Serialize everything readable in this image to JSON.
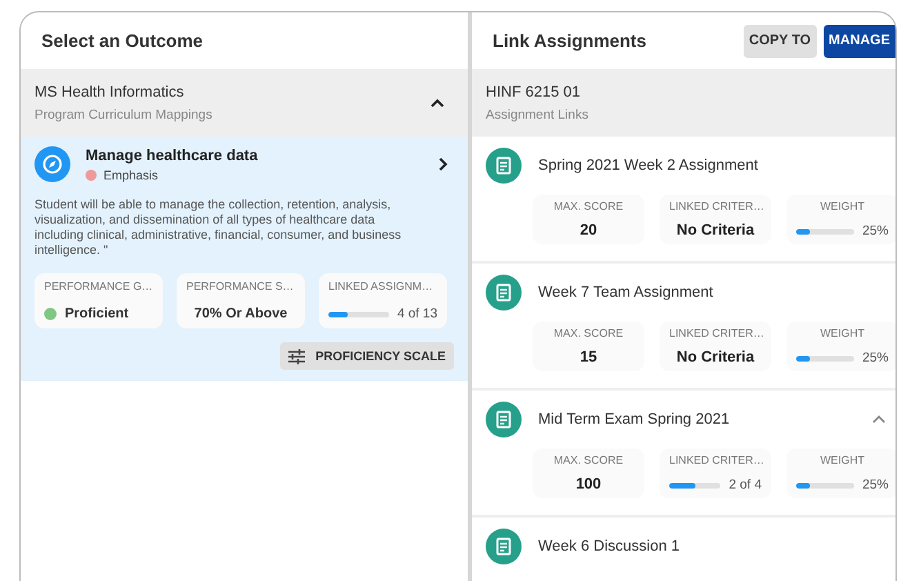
{
  "left_panel": {
    "title": "Select an Outcome",
    "program": {
      "name": "MS Health Informatics",
      "subtitle": "Program Curriculum Mappings",
      "expanded": true
    },
    "outcome": {
      "title": "Manage healthcare data",
      "tag": "Emphasis",
      "color": "#ef9a9a",
      "selected": true,
      "description": "Student will be able to manage the collection, retention, analysis, visualization, and dissemination of all types of healthcare data including clinical, administrative, financial, consumer, and business intelligence. \"",
      "stats": [
        {
          "kind": "dot",
          "label": "PERFORMANCE G…",
          "value": "Proficient",
          "color": "#81c784"
        },
        {
          "kind": "text",
          "label": "PERFORMANCE S…",
          "value": "70% Or Above"
        },
        {
          "kind": "bar",
          "label": "LINKED ASSIGNM…",
          "value": "4 of 13",
          "level": 0.31
        }
      ],
      "button": "PROFICIENCY SCALE"
    }
  },
  "right_panel": {
    "title": "Link Assignments",
    "buttons": [
      {
        "label": "COPY TO",
        "kind": "secondary"
      },
      {
        "label": "MANAGE",
        "kind": "primary"
      }
    ],
    "course": {
      "name": "HINF 6215 01",
      "subtitle": "Assignment Links"
    },
    "assignments": [
      {
        "title": "Spring 2021 Week 2 Assignment",
        "stats": [
          {
            "kind": "text",
            "label": "MAX. SCORE",
            "value": "20"
          },
          {
            "kind": "text",
            "label": "LINKED CRITER…",
            "value": "No Criteria"
          },
          {
            "kind": "bar",
            "label": "WEIGHT",
            "value": "25%",
            "level": 0.25
          }
        ]
      },
      {
        "title": "Week 7 Team Assignment",
        "stats": [
          {
            "kind": "text",
            "label": "MAX. SCORE",
            "value": "15"
          },
          {
            "kind": "text",
            "label": "LINKED CRITER…",
            "value": "No Criteria"
          },
          {
            "kind": "bar",
            "label": "WEIGHT",
            "value": "25%",
            "level": 0.25
          }
        ]
      },
      {
        "title": "Mid Term Exam Spring 2021",
        "expanded": true,
        "stats": [
          {
            "kind": "text",
            "label": "MAX. SCORE",
            "value": "100"
          },
          {
            "kind": "bar",
            "label": "LINKED CRITER…",
            "value": "2 of 4",
            "level": 0.5
          },
          {
            "kind": "bar",
            "label": "WEIGHT",
            "value": "25%",
            "level": 0.25
          }
        ]
      },
      {
        "title": "Week 6 Discussion 1"
      }
    ]
  }
}
